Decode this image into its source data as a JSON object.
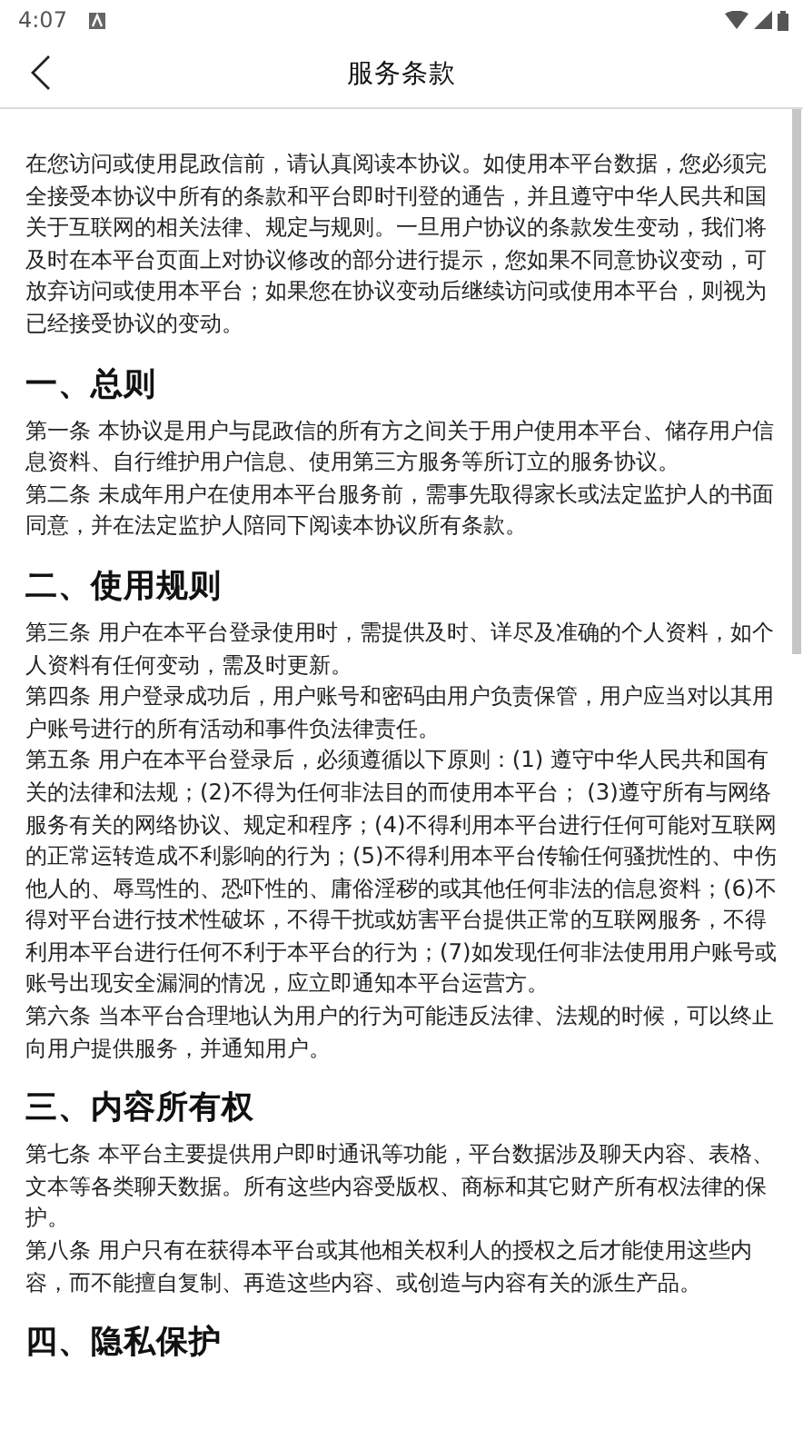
{
  "status_bar": {
    "time": "4:07"
  },
  "header": {
    "title": "服务条款"
  },
  "intro": "在您访问或使用昆政信前，请认真阅读本协议。如使用本平台数据，您必须完全接受本协议中所有的条款和平台即时刊登的通告，并且遵守中华人民共和国关于互联网的相关法律、规定与规则。一旦用户协议的条款发生变动，我们将及时在本平台页面上对协议修改的部分进行提示，您如果不同意协议变动，可放弃访问或使用本平台；如果您在协议变动后继续访问或使用本平台，则视为已经接受协议的变动。",
  "sections": [
    {
      "heading": "一、总则",
      "paragraphs": [
        "第一条 本协议是用户与昆政信的所有方之间关于用户使用本平台、储存用户信息资料、自行维护用户信息、使用第三方服务等所订立的服务协议。",
        "第二条 未成年用户在使用本平台服务前，需事先取得家长或法定监护人的书面同意，并在法定监护人陪同下阅读本协议所有条款。"
      ]
    },
    {
      "heading": "二、使用规则",
      "paragraphs": [
        "第三条 用户在本平台登录使用时，需提供及时、详尽及准确的个人资料，如个人资料有任何变动，需及时更新。",
        "第四条 用户登录成功后，用户账号和密码由用户负责保管，用户应当对以其用户账号进行的所有活动和事件负法律责任。",
        "第五条 用户在本平台登录后，必须遵循以下原则：(1) 遵守中华人民共和国有关的法律和法规；(2)不得为任何非法目的而使用本平台； (3)遵守所有与网络服务有关的网络协议、规定和程序；(4)不得利用本平台进行任何可能对互联网的正常运转造成不利影响的行为；(5)不得利用本平台传输任何骚扰性的、中伤他人的、辱骂性的、恐吓性的、庸俗淫秽的或其他任何非法的信息资料；(6)不得对平台进行技术性破坏，不得干扰或妨害平台提供正常的互联网服务，不得利用本平台进行任何不利于本平台的行为；(7)如发现任何非法使用用户账号或账号出现安全漏洞的情况，应立即通知本平台运营方。",
        "第六条 当本平台合理地认为用户的行为可能违反法律、法规的时候，可以终止向用户提供服务，并通知用户。"
      ]
    },
    {
      "heading": "三、内容所有权",
      "paragraphs": [
        "第七条 本平台主要提供用户即时通讯等功能，平台数据涉及聊天内容、表格、文本等各类聊天数据。所有这些内容受版权、商标和其它财产所有权法律的保护。",
        "第八条 用户只有在获得本平台或其他相关权利人的授权之后才能使用这些内容，而不能擅自复制、再造这些内容、或创造与内容有关的派生产品。"
      ]
    },
    {
      "heading": "四、隐私保护"
    }
  ]
}
